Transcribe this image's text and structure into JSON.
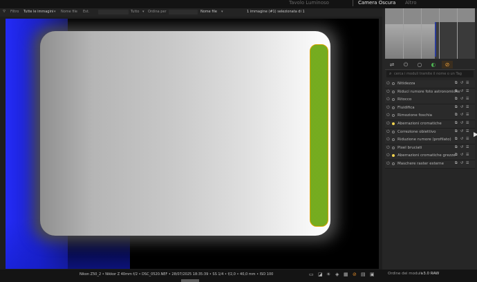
{
  "views": {
    "left_view": "Tavolo Luminoso",
    "active_view": "Camera Oscura",
    "right_view": "Altro"
  },
  "filterbar": {
    "filter_label": "Filtro",
    "filter_value": "Tutte le immagini",
    "name_field": "Nome file",
    "ext_field": "Est.",
    "all_value": "Tutto",
    "sort_label": "Ordina per",
    "sort_value": "Nome file",
    "selection_status": "1 immagine (#1) selezionata di 1"
  },
  "colors": {
    "accent": "#e59b3a",
    "active_dot": "#f0d250",
    "overexposed_strip": "#e0c220",
    "underexposed_noise": "#1c24f0"
  },
  "module_panel": {
    "tab_icons": [
      "presets-icon",
      "power-icon",
      "circle-icon",
      "color-icon",
      "correct-icon"
    ],
    "active_tab_index": 4,
    "search_placeholder": "cerca i moduli tramite il nome o un Tag",
    "modules": [
      {
        "label": "Nitidezza",
        "state": "off"
      },
      {
        "label": "Riduci rumore foto astronomiche",
        "state": "off"
      },
      {
        "label": "Ritocco",
        "state": "off"
      },
      {
        "label": "Fluidifica",
        "state": "off"
      },
      {
        "label": "Rimozione foschia",
        "state": "off"
      },
      {
        "label": "Aberrazioni cromatiche",
        "state": "on"
      },
      {
        "label": "Correzione obiettivo",
        "state": "off"
      },
      {
        "label": "Riduzione rumore (profilato)",
        "state": "off"
      },
      {
        "label": "Pixel bruciati",
        "state": "off"
      },
      {
        "label": "Aberrazioni cromatiche grezze",
        "state": "on"
      },
      {
        "label": "Maschere raster esterne",
        "state": "off"
      }
    ]
  },
  "statusbar": {
    "exif": "Nikon Z50_2 • Nikkor Z 40mm f/2 • DSC_0520.NEF • 28/07/2025 18:35:39 • SS 1/4 • f/2,0 • 40,0 mm • ISO 100",
    "module_order_label": "Ordine dei moduli",
    "module_order_value": "v3.0 RAW"
  }
}
